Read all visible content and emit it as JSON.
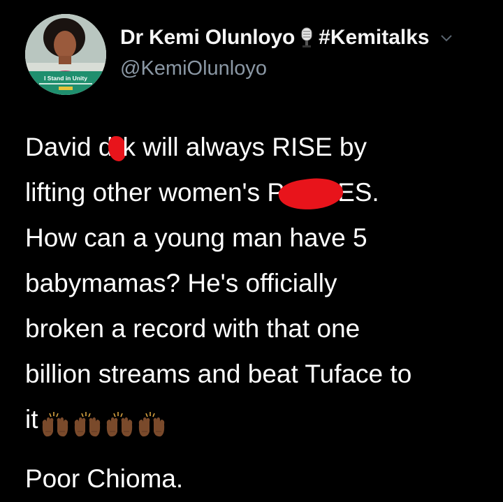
{
  "author": {
    "display_name": "Dr Kemi Olunloyo",
    "name_suffix": "#Kemitalks",
    "handle": "@KemiOlunloyo",
    "avatar_banner_text": "I Stand in Unity",
    "mic_icon": "microphone-emoji",
    "menu_icon": "chevron-down-icon"
  },
  "tweet": {
    "line1_a": "David d",
    "line1_b": "k will always RISE by",
    "line2_a": "lifting other women's P",
    "line2_b": "ES.",
    "line3": "How can a young man have 5",
    "line4": "babymamas? He's officially",
    "line5": "broken a record with that one",
    "line6": "billion streams and beat Tuface to",
    "line7": "it",
    "emoji": "raising-hands-dark-skin-tone",
    "emoji_count": 4,
    "closing": "Poor Chioma."
  },
  "colors": {
    "background": "#000000",
    "text": "#ffffff",
    "handle": "#8b98a5",
    "redaction": "#e8141b",
    "avatar_banner": "#1f8f6e"
  }
}
